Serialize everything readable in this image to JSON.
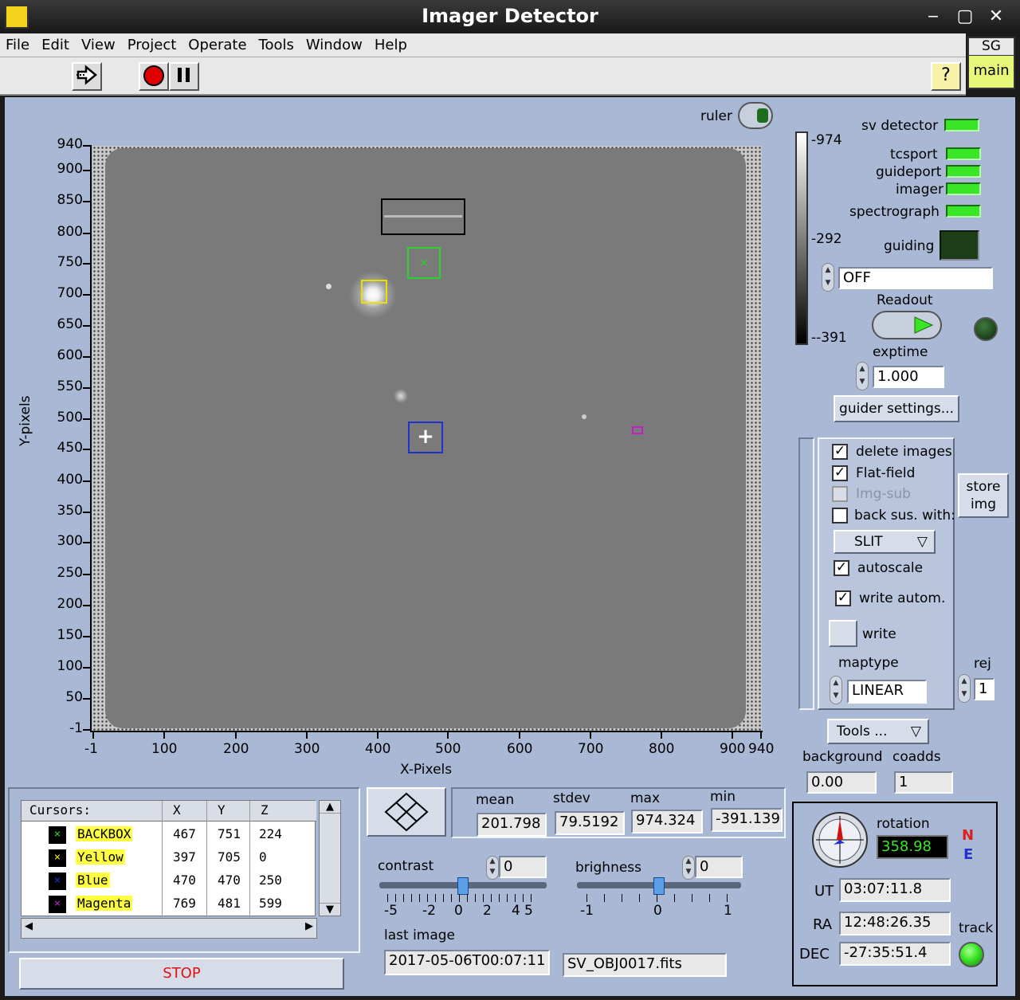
{
  "window": {
    "title": "Imager Detector",
    "minimize": "‒",
    "maximize": "▢",
    "close": "✕"
  },
  "menu": [
    "File",
    "Edit",
    "View",
    "Project",
    "Operate",
    "Tools",
    "Window",
    "Help"
  ],
  "toolbar": {
    "run_icon": "run-arrow-icon",
    "stop_icon": "record-stop-icon",
    "pause_icon": "pause-icon",
    "help_icon": "question-icon"
  },
  "sg": {
    "top": "SG",
    "bottom": "main"
  },
  "ruler_label": "ruler",
  "plot": {
    "ylabel": "Y-pixels",
    "xlabel": "X-Pixels",
    "yticks": [
      "940",
      "900",
      "850",
      "800",
      "750",
      "700",
      "650",
      "600",
      "550",
      "500",
      "450",
      "400",
      "350",
      "300",
      "250",
      "200",
      "150",
      "100",
      "50",
      "-1"
    ],
    "xticks": [
      "-1",
      "100",
      "200",
      "300",
      "400",
      "500",
      "600",
      "700",
      "800",
      "900",
      "940"
    ]
  },
  "colorbar": {
    "max": "-974",
    "mid": "-292",
    "min": "--391"
  },
  "status": [
    {
      "label": "sv detector",
      "state": "on"
    },
    {
      "label": "tcsport",
      "state": "on"
    },
    {
      "label": "guideport",
      "state": "on"
    },
    {
      "label": "imager",
      "state": "on"
    },
    {
      "label": "spectrograph",
      "state": "on"
    },
    {
      "label": "guiding",
      "state": "off"
    }
  ],
  "guiding_mode": "OFF",
  "readout_label": "Readout",
  "exptime_label": "exptime",
  "exptime": "1.000",
  "guider_settings": "guider settings...",
  "options": {
    "delete_images": "delete images",
    "flat_field": "Flat-field",
    "img_sub": "Img-sub",
    "back_sus": "back sus. with:",
    "back_mode": "SLIT",
    "autoscale": "autoscale",
    "write_autom": "write autom.",
    "write": "write",
    "maptype_label": "maptype",
    "maptype": "LINEAR",
    "store_img": "store img",
    "rej_label": "rej",
    "rej": "1"
  },
  "tools": {
    "label": "Tools ...",
    "background_label": "background",
    "coadds_label": "coadds",
    "background": "0.00",
    "coadds": "1"
  },
  "cursors": {
    "header": [
      "Cursors:",
      "X",
      "Y",
      "Z"
    ],
    "rows": [
      {
        "name": "BACKBOX",
        "x": "467",
        "y": "751",
        "z": "224",
        "color": "#2bd42b"
      },
      {
        "name": "Yellow",
        "x": "397",
        "y": "705",
        "z": "0",
        "color": "#e8e000"
      },
      {
        "name": "Blue",
        "x": "470",
        "y": "470",
        "z": "250",
        "color": "#2230d0"
      },
      {
        "name": "Magenta",
        "x": "769",
        "y": "481",
        "z": "599",
        "color": "#c020c0"
      }
    ]
  },
  "stop_label": "STOP",
  "stats": {
    "mean_label": "mean",
    "stdev_label": "stdev",
    "max_label": "max",
    "min_label": "min",
    "mean": "201.798",
    "stdev": "79.5192",
    "max": "974.324",
    "min": "-391.139"
  },
  "contrast": {
    "label": "contrast",
    "value": "0",
    "ticks": [
      "-5",
      "-2",
      "0",
      "2",
      "4",
      "5"
    ],
    "position": 0.5
  },
  "brightness": {
    "label": "brighness",
    "value": "0",
    "ticks": [
      "-1",
      "0",
      "1"
    ],
    "position": 0.5
  },
  "last_image_label": "last image",
  "last_image": "2017-05-06T00:07:11",
  "filename": "SV_OBJ0017.fits",
  "rotation_label": "rotation",
  "rotation": "358.98",
  "compass": {
    "n": "N",
    "e": "E"
  },
  "ut_label": "UT",
  "ut": "03:07:11.8",
  "ra_label": "RA",
  "ra": "12:48:26.35",
  "dec_label": "DEC",
  "dec": "-27:35:51.4",
  "track_label": "track"
}
